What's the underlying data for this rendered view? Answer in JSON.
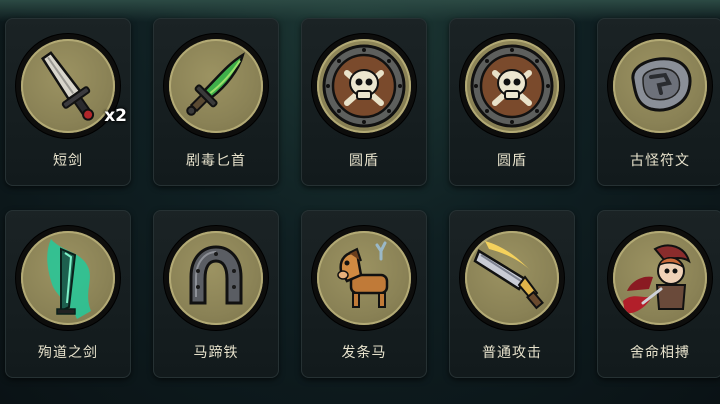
{
  "items": [
    {
      "label": "短剑",
      "icon": "dagger-icon",
      "count": "x2"
    },
    {
      "label": "剧毒匕首",
      "icon": "poison-dagger-icon"
    },
    {
      "label": "圆盾",
      "icon": "skull-shield-icon"
    },
    {
      "label": "圆盾",
      "icon": "skull-shield-icon"
    },
    {
      "label": "古怪符文",
      "icon": "strange-rune-icon"
    },
    {
      "label": "殉道之剑",
      "icon": "martyr-sword-icon"
    },
    {
      "label": "马蹄铁",
      "icon": "horseshoe-icon"
    },
    {
      "label": "发条马",
      "icon": "clockwork-horse-icon"
    },
    {
      "label": "普通攻击",
      "icon": "basic-attack-icon"
    },
    {
      "label": "舍命相搏",
      "icon": "desperate-strike-icon"
    }
  ],
  "colors": {
    "medal_fill": "#8a8256",
    "label_text": "#e7e2cc",
    "card_bg": "#161e20"
  }
}
